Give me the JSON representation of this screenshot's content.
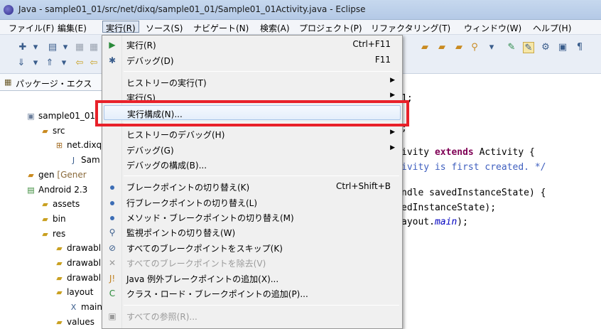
{
  "window": {
    "title": "Java - sample01_01/src/net/dixq/sample01_01/Sample01_01Activity.java - Eclipse"
  },
  "menubar": {
    "items": [
      "ファイル(F)",
      "編集(E)",
      "実行(R)",
      "ソース(S)",
      "ナビゲート(N)",
      "検索(A)",
      "プロジェクト(P)",
      "リファクタリング(T)",
      "ウィンドウ(W)",
      "ヘルプ(H)"
    ],
    "active": "実行(R)"
  },
  "package_explorer": {
    "tab_label": "パッケージ・エクス",
    "tree": [
      "sample01_01",
      "src",
      "net.dixq",
      "Sam",
      "gen [Gener",
      "Android 2.3",
      "assets",
      "bin",
      "res",
      "drawabl",
      "drawabl",
      "drawabl",
      "layout",
      "main",
      "values"
    ]
  },
  "editor": {
    "lines": [
      {
        "segments": [
          {
            "t": "1;",
            "c": ""
          }
        ]
      },
      {
        "segments": [
          {
            "t": ";",
            "c": ""
          }
        ]
      },
      {
        "segments": [
          {
            "t": "ivity ",
            "c": ""
          },
          {
            "t": "extends",
            "c": "kw"
          },
          {
            "t": " Activity {",
            "c": ""
          }
        ]
      },
      {
        "segments": [
          {
            "t": "ivity is first created. */",
            "c": "cm"
          }
        ]
      },
      {
        "segments": [
          {
            "t": "ndle savedInstanceState) {",
            "c": ""
          }
        ]
      },
      {
        "segments": [
          {
            "t": "edInstanceState);",
            "c": ""
          }
        ]
      },
      {
        "segments": [
          {
            "t": "ayout.",
            "c": ""
          },
          {
            "t": "main",
            "c": "it"
          },
          {
            "t": ");",
            "c": ""
          }
        ]
      }
    ]
  },
  "run_menu": {
    "items": [
      {
        "label": "実行(R)",
        "shortcut": "Ctrl+F11",
        "icon": "run-icon",
        "glyph": "▶"
      },
      {
        "label": "デバッグ(D)",
        "shortcut": "F11",
        "icon": "debug-icon",
        "glyph": "✱"
      },
      {
        "label": "ヒストリーの実行(T)",
        "submenu": true
      },
      {
        "label": "実行(S)",
        "submenu": true
      },
      {
        "label": "実行構成(N)...",
        "hover": true
      },
      {
        "label": "ヒストリーのデバッグ(H)",
        "submenu": true
      },
      {
        "label": "デバッグ(G)",
        "submenu": true
      },
      {
        "label": "デバッグの構成(B)..."
      },
      {
        "label": "ブレークポイントの切り替え(K)",
        "shortcut": "Ctrl+Shift+B",
        "icon": "breakpoint-icon",
        "glyph": "dot"
      },
      {
        "label": "行ブレークポイントの切り替え(L)",
        "icon": "line-breakpoint-icon",
        "glyph": "dot"
      },
      {
        "label": "メソッド・ブレークポイントの切り替え(M)",
        "icon": "method-breakpoint-icon",
        "glyph": "dot"
      },
      {
        "label": "監視ポイントの切り替え(W)",
        "icon": "watchpoint-icon",
        "glyph": "⚲"
      },
      {
        "label": "すべてのブレークポイントをスキップ(K)",
        "icon": "skip-breakpoints-icon",
        "glyph": "⊘"
      },
      {
        "label": "すべてのブレークポイントを除去(V)",
        "icon": "remove-breakpoints-icon",
        "glyph": "✕",
        "disabled": true
      },
      {
        "label": "Java 例外ブレークポイントの追加(X)...",
        "icon": "exception-breakpoint-icon",
        "glyph": "J!"
      },
      {
        "label": "クラス・ロード・ブレークポイントの追加(P)...",
        "icon": "class-load-breakpoint-icon",
        "glyph": "C"
      },
      {
        "label": "すべての参照(R)...",
        "icon": "references-icon",
        "glyph": "▣",
        "disabled": true
      }
    ]
  },
  "colors": {
    "highlight_box": "#e8212a",
    "menu_hover": "#e4eefb"
  }
}
